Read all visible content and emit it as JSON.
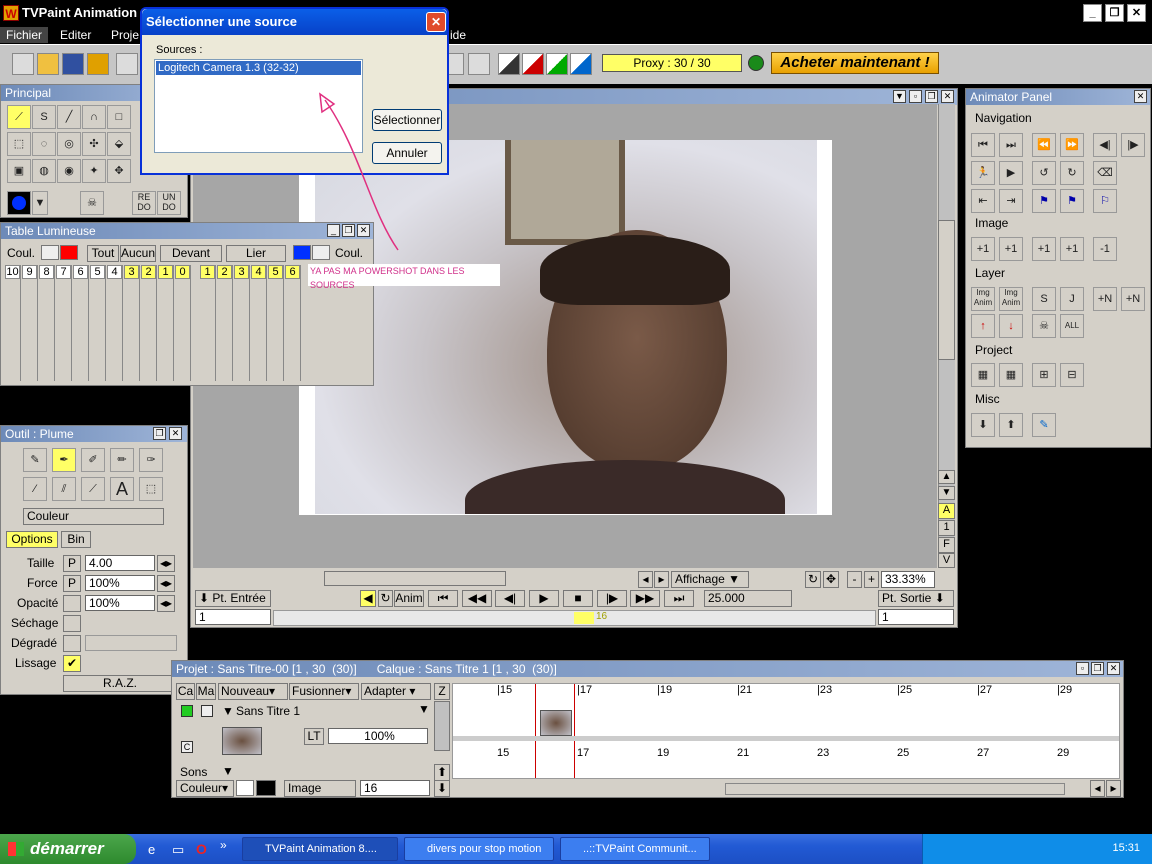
{
  "app": {
    "title": "TVPaint Animation",
    "logo": "W"
  },
  "menu": [
    "Fichier",
    "Editer",
    "Proje",
    "ide"
  ],
  "toolbar": {
    "proxy": "Proxy : 30 / 30",
    "buy": "Acheter maintenant !"
  },
  "dialog": {
    "title": "Sélectionner une source",
    "sources_label": "Sources :",
    "source_item": "Logitech Camera 1.3 (32-32)",
    "select": "Sélectionner",
    "cancel": "Annuler",
    "close": "✕"
  },
  "annotation": "YA PAS MA POWERSHOT DANS LES SOURCES",
  "principal": {
    "title": "Principal",
    "redo": "RE DO",
    "undo": "UN DO"
  },
  "lumineuse": {
    "title": "Table Lumineuse",
    "coul": "Coul.",
    "tout": "Tout",
    "aucun": "Aucun",
    "devant": "Devant",
    "lier": "Lier",
    "coul2": "Coul.",
    "left_nums": [
      "10",
      "9",
      "8",
      "7",
      "6",
      "5",
      "4",
      "3",
      "2",
      "1"
    ],
    "zero": "0",
    "right_nums": [
      "1",
      "2",
      "3",
      "4",
      "5",
      "6"
    ]
  },
  "outil": {
    "title": "Outil : Plume",
    "color_select": "Couleur",
    "tab_options": "Options",
    "tab_bin": "Bin",
    "taille_label": "Taille",
    "taille": "4.00",
    "force_label": "Force",
    "force": "100%",
    "opacite_label": "Opacité",
    "opacite": "100%",
    "sechage": "Séchage",
    "degrade": "Dégradé",
    "lissage": "Lissage",
    "p": "P",
    "raz": "R.A.Z."
  },
  "viewer": {
    "affichage": "Affichage",
    "zoom": "33.33%",
    "pt_entree": "Pt. Entrée",
    "anim": "Anim",
    "fps": "25.000",
    "pt_sortie": "Pt. Sortie",
    "frame_in": "1",
    "frame_out": "1",
    "side_letters": [
      "A",
      "1",
      "F",
      "V"
    ],
    "pos_marker": "16"
  },
  "animator": {
    "title": "Animator Panel",
    "navigation": "Navigation",
    "image": "Image",
    "layer": "Layer",
    "project": "Project",
    "misc": "Misc",
    "img_anim": "Img Anim",
    "all": "ALL"
  },
  "timeline": {
    "title": "Projet : Sans Titre-00 [1 , 30  (30)]      Calque : Sans Titre 1 [1 , 30  (30)]",
    "col_ca": "Ca",
    "col_ma": "Ma",
    "nouveau": "Nouveau",
    "fusionner": "Fusionner",
    "adapter": "Adapter",
    "z": "Z",
    "layer_name": "Sans Titre 1",
    "lt": "LT",
    "opacity": "100%",
    "sons": "Sons",
    "couleur": "Couleur",
    "image": "Image",
    "image_val": "16",
    "ticks": [
      "15",
      "17",
      "19",
      "21",
      "23",
      "25",
      "27",
      "29"
    ],
    "bottom_ticks": [
      "15",
      "17",
      "19",
      "21",
      "23",
      "25",
      "27",
      "29"
    ],
    "c": "C"
  },
  "taskbar": {
    "start": "démarrer",
    "tasks": [
      "TVPaint Animation 8....",
      "divers pour stop motion",
      "..::TVPaint Communit..."
    ],
    "clock": "15:31"
  },
  "colors": {
    "accent": "#0a5fe8",
    "panel": "#d4d0c8",
    "yellow": "#ffff66"
  }
}
